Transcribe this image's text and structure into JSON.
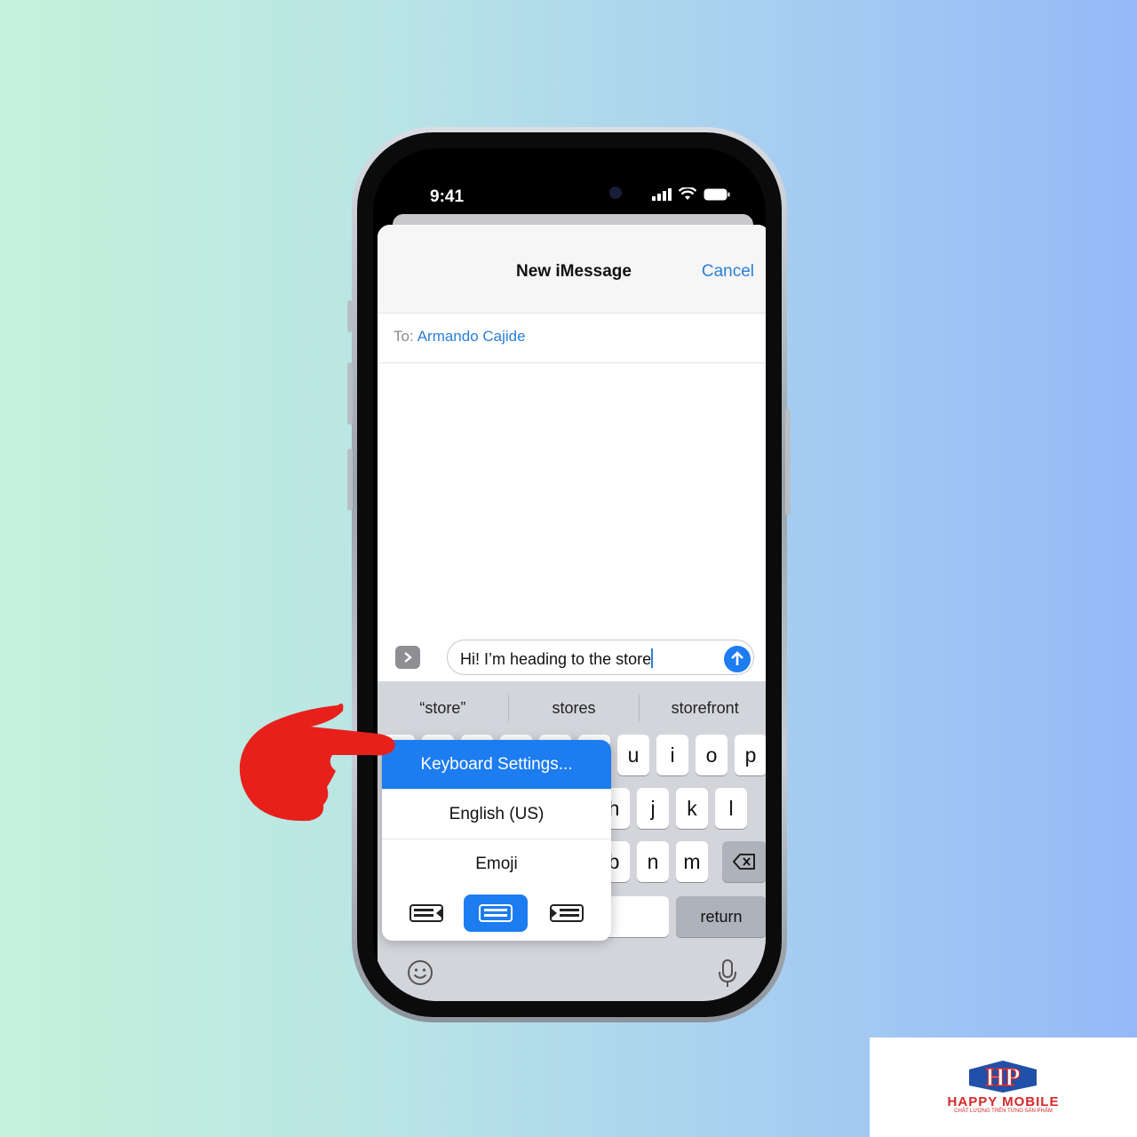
{
  "status": {
    "time": "9:41"
  },
  "nav": {
    "title": "New iMessage",
    "cancel": "Cancel"
  },
  "recipient": {
    "label": "To:",
    "name": "Armando Cajide"
  },
  "composer": {
    "text": "Hi! I’m heading to the store"
  },
  "suggestions": [
    "“store”",
    "stores",
    "storefront"
  ],
  "keys": {
    "row1": [
      "u",
      "i",
      "o",
      "p"
    ],
    "row2": [
      "h",
      "j",
      "k",
      "l"
    ],
    "row3": [
      "b",
      "n",
      "m"
    ],
    "return": "return"
  },
  "popup": {
    "items": [
      "Keyboard Settings...",
      "English (US)",
      "Emoji"
    ],
    "selected": "Keyboard Settings..."
  },
  "watermark": {
    "brand": "HAPPY MOBILE",
    "tagline": "CHẤT LƯỢNG TRÊN TỪNG SẢN PHẨM",
    "initials": "HP"
  },
  "colors": {
    "accent": "#1c7cf0",
    "link": "#2a7fd6",
    "pointer": "#e8201c"
  }
}
